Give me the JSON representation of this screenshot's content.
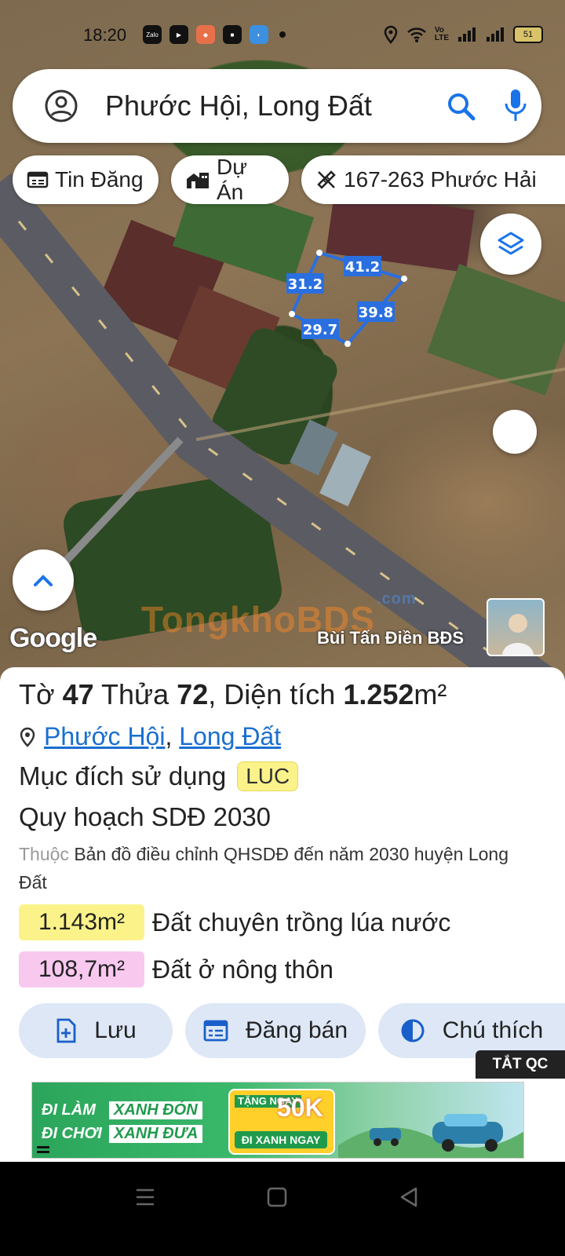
{
  "status_bar": {
    "time": "18:20",
    "apps": [
      "Zalo",
      "play-icon",
      "game-icon",
      "app-icon",
      "browser-icon"
    ],
    "battery": "51"
  },
  "search": {
    "query": "Phước Hội, Long Đất",
    "account_icon": "account-circle-icon",
    "search_icon": "search-icon",
    "mic_icon": "mic-icon"
  },
  "chips": [
    {
      "label": "Tin Đăng",
      "icon": "listing-icon"
    },
    {
      "label": "Dự Án",
      "icon": "buildings-icon"
    },
    {
      "label": "167-263 Phước Hải",
      "icon": "ruler-icon"
    }
  ],
  "map": {
    "parcel_dimensions": [
      "41.2",
      "31.2",
      "39.8",
      "29.7"
    ],
    "google_logo": "Google",
    "watermark": "TongkhoBDS",
    "watermark_suffix": ".com",
    "author": "Bùi Tấn Điền BĐS"
  },
  "parcel": {
    "sheet_label": "Tờ",
    "sheet_no": "47",
    "plot_label": "Thửa",
    "plot_no": "72",
    "area_label": ", Diện tích",
    "area_value": "1.252",
    "area_unit": "m²",
    "ward": "Phước Hội",
    "district": "Long Đất",
    "purpose_label": "Mục đích sử dụng",
    "purpose_code": "LUC",
    "plan_label": "Quy hoạch SDĐ 2030",
    "desc_prefix": "Thuộc",
    "desc_text": "Bản đồ điều chỉnh QHSDĐ đến năm 2030 huyện Long Đất",
    "zones": [
      {
        "area": "1.143m²",
        "name": "Đất chuyên trồng lúa nước",
        "color": "#fbf38a"
      },
      {
        "area": "108,7m²",
        "name": "Đất ở nông thôn",
        "color": "#f8c8ef"
      }
    ]
  },
  "actions": [
    {
      "label": "Lưu",
      "icon": "save-doc-icon"
    },
    {
      "label": "Đăng bán",
      "icon": "calendar-list-icon"
    },
    {
      "label": "Chú thích",
      "icon": "contrast-icon"
    }
  ],
  "ad": {
    "close_label": "TẮT QC",
    "line1_a": "ĐI LÀM",
    "line1_b": "XANH ĐÓN",
    "line2_a": "ĐI CHƠI",
    "line2_b": "XANH ĐƯA",
    "promo_top": "TẶNG NGAY",
    "promo_value": "50K",
    "promo_cta": "ĐI XANH NGAY"
  },
  "colors": {
    "accent_blue": "#1a6fd1",
    "parcel_blue": "#2a6fe0",
    "action_bg": "#dde7f6"
  }
}
